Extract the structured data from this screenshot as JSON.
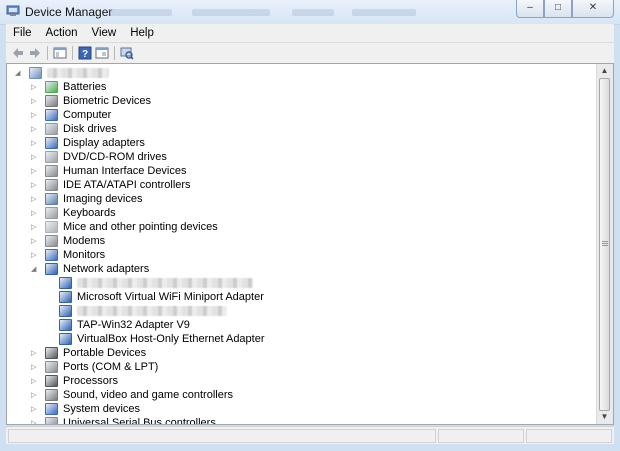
{
  "window": {
    "title": "Device Manager",
    "minimize_glyph": "–",
    "maximize_glyph": "□",
    "close_glyph": "✕"
  },
  "menubar": {
    "items": [
      "File",
      "Action",
      "View",
      "Help"
    ]
  },
  "toolbar": {
    "icons": [
      "back-icon",
      "forward-icon",
      "show-hide-console-tree-icon",
      "help-icon",
      "properties-icon",
      "scan-hardware-icon"
    ]
  },
  "tree": {
    "root": {
      "label": "",
      "icon": "computer-root-icon",
      "expanded": true
    },
    "categories": [
      {
        "label": "Batteries",
        "icon": "battery-icon",
        "expanded": false
      },
      {
        "label": "Biometric Devices",
        "icon": "biometric-icon",
        "expanded": false
      },
      {
        "label": "Computer",
        "icon": "computer-icon",
        "expanded": false
      },
      {
        "label": "Disk drives",
        "icon": "disk-drive-icon",
        "expanded": false
      },
      {
        "label": "Display adapters",
        "icon": "display-adapter-icon",
        "expanded": false
      },
      {
        "label": "DVD/CD-ROM drives",
        "icon": "dvd-drive-icon",
        "expanded": false
      },
      {
        "label": "Human Interface Devices",
        "icon": "hid-icon",
        "expanded": false
      },
      {
        "label": "IDE ATA/ATAPI controllers",
        "icon": "ide-controller-icon",
        "expanded": false
      },
      {
        "label": "Imaging devices",
        "icon": "imaging-icon",
        "expanded": false
      },
      {
        "label": "Keyboards",
        "icon": "keyboard-icon",
        "expanded": false
      },
      {
        "label": "Mice and other pointing devices",
        "icon": "mouse-icon",
        "expanded": false
      },
      {
        "label": "Modems",
        "icon": "modem-icon",
        "expanded": false
      },
      {
        "label": "Monitors",
        "icon": "monitor-icon",
        "expanded": false
      },
      {
        "label": "Network adapters",
        "icon": "network-adapter-icon",
        "expanded": true
      }
    ],
    "network_children": [
      {
        "label": "",
        "icon": "network-adapter-icon"
      },
      {
        "label": "Microsoft Virtual WiFi Miniport Adapter",
        "icon": "network-adapter-icon"
      },
      {
        "label": "",
        "icon": "network-adapter-icon"
      },
      {
        "label": "TAP-Win32 Adapter V9",
        "icon": "network-adapter-icon"
      },
      {
        "label": "VirtualBox Host-Only Ethernet Adapter",
        "icon": "network-adapter-icon"
      }
    ],
    "categories_after": [
      {
        "label": "Portable Devices",
        "icon": "portable-device-icon",
        "expanded": false
      },
      {
        "label": "Ports (COM & LPT)",
        "icon": "port-icon",
        "expanded": false
      },
      {
        "label": "Processors",
        "icon": "processor-icon",
        "expanded": false
      },
      {
        "label": "Sound, video and game controllers",
        "icon": "sound-icon",
        "expanded": false
      },
      {
        "label": "System devices",
        "icon": "system-device-icon",
        "expanded": false
      },
      {
        "label": "Universal Serial Bus controllers",
        "icon": "usb-icon",
        "expanded": false
      }
    ]
  },
  "scrollbar": {
    "up_glyph": "▲",
    "down_glyph": "▼"
  },
  "tree_glyphs": {
    "collapsed": "▷",
    "expanded": "◢"
  },
  "colors": {
    "frame": "#cfe0f3",
    "chrome": "#f0f0f0",
    "accent_blue": "#2f62b5",
    "green": "#3aa53a"
  }
}
